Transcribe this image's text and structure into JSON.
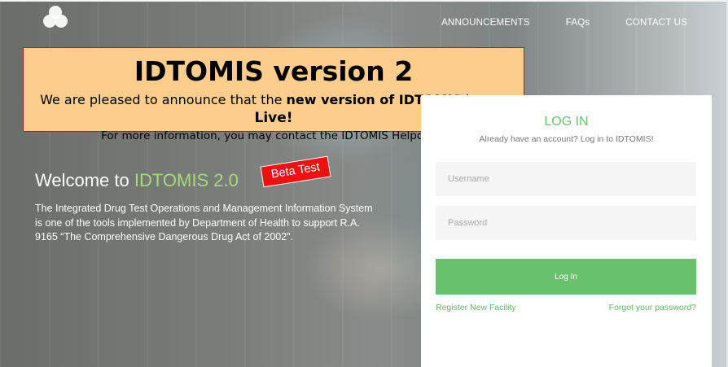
{
  "nav": {
    "announcements": "ANNOUNCEMENTS",
    "faqs": "FAQs",
    "contact": "CONTACT US"
  },
  "logo": {
    "icon": "three-circles-logo"
  },
  "banner": {
    "title": "IDTOMIS version 2",
    "line1_pre": "We are pleased to announce that the ",
    "line1_bold": "new version of IDTOMIS",
    "line1_mid": " is now ",
    "line1_live": "Live!",
    "line2": "For more information, you may contact the IDTOMIS Helpdesk."
  },
  "welcome": {
    "prefix": "Welcome to ",
    "accent": "IDTOMIS 2.0",
    "badge": "Beta Test",
    "description": "The Integrated Drug Test Operations and Management Information System is one of the tools implemented by Department of Health to support R.A. 9165 “The Comprehensive Dangerous Drug Act of 2002”."
  },
  "login": {
    "title": "LOG IN",
    "subtitle": "Already have an account? Log in to IDTOMIS!",
    "username_placeholder": "Username",
    "password_placeholder": "Password",
    "button": "Log In",
    "register_link": "Register New Facility",
    "forgot_link": "Forgot your password?"
  },
  "colors": {
    "accent_green": "#66c26c",
    "banner_bg": "#fdcd8d",
    "banner_border": "#c4161c",
    "badge_red": "#ee1111"
  }
}
